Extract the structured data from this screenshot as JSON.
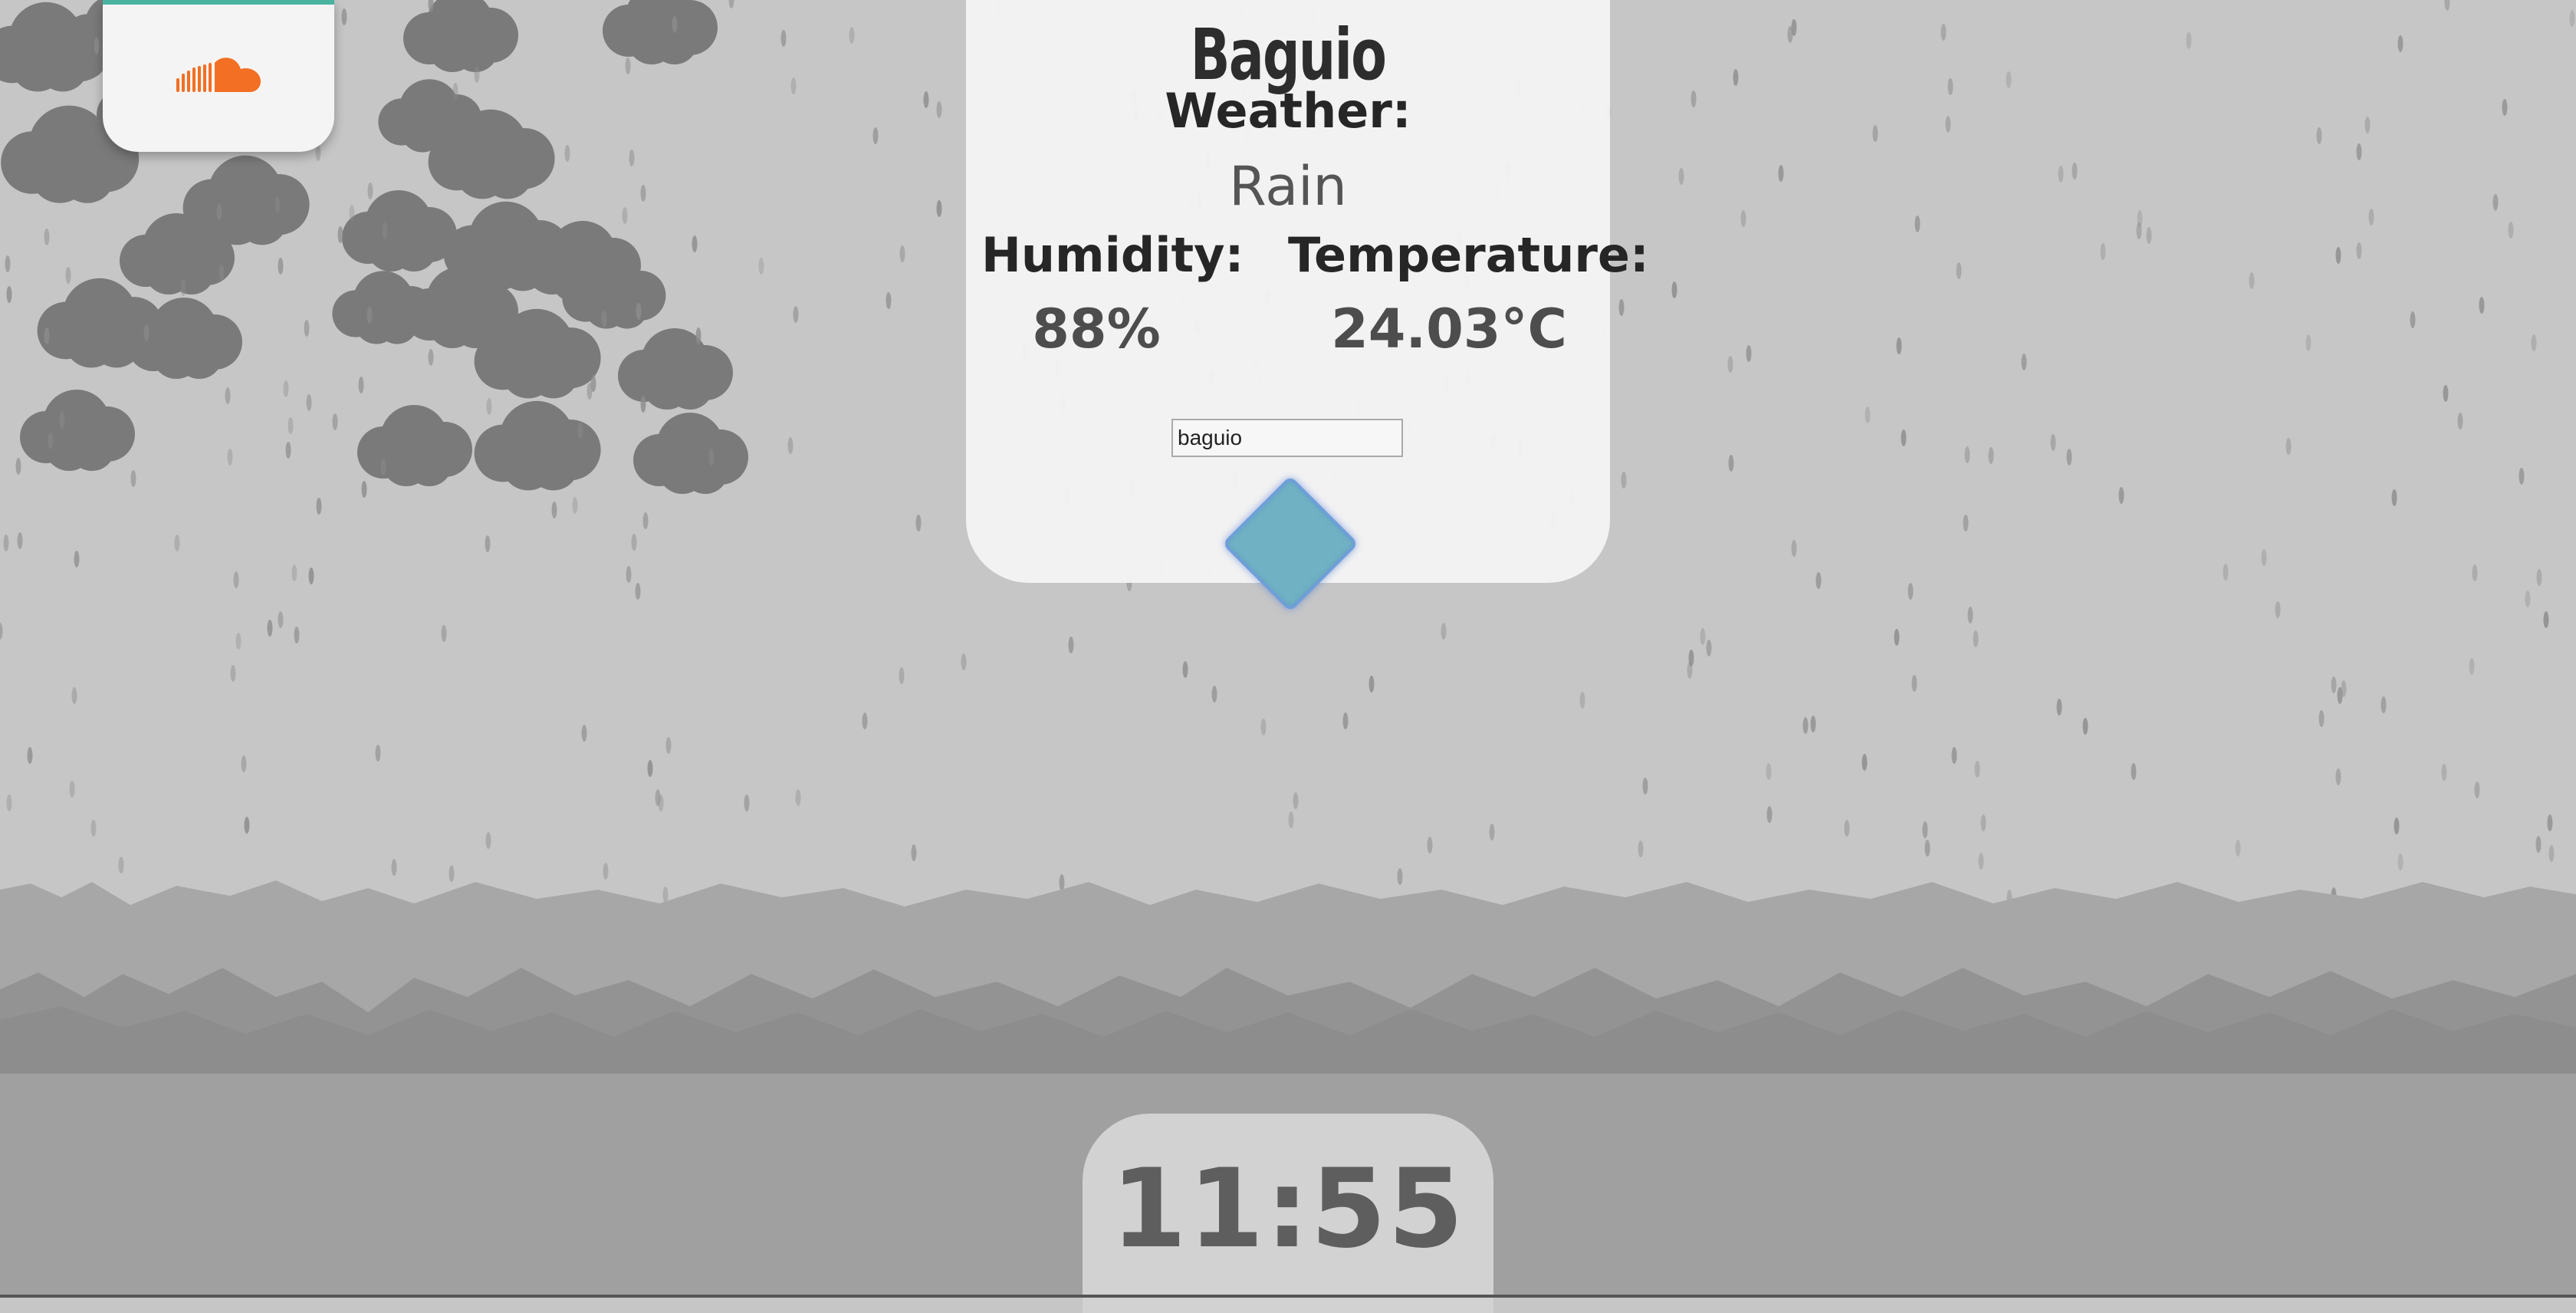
{
  "weather": {
    "city": "Baguio",
    "weather_label": "Weather:",
    "condition": "Rain",
    "humidity_label": "Humidity:",
    "humidity_value": "88%",
    "temperature_label": "Temperature:",
    "temperature_value": "24.03°C"
  },
  "search": {
    "value": "baguio"
  },
  "clock": {
    "time": "11:55"
  },
  "widget": {
    "icon": "soundcloud-icon"
  },
  "colors": {
    "background": "#c6c6c6",
    "card": "#f4f4f4",
    "soundcloud_orange": "#f26f23",
    "accent_teal": "#4ab3a0",
    "diamond": "#70b2c3"
  }
}
